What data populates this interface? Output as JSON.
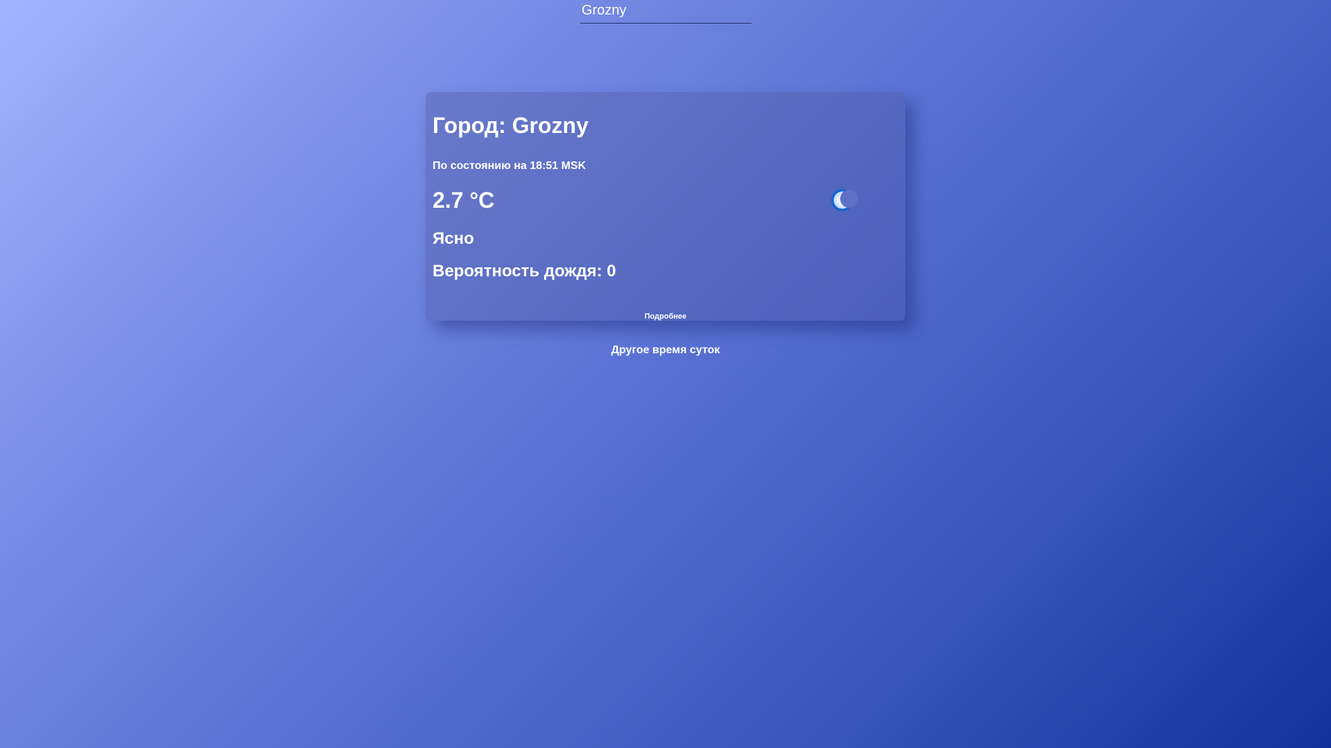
{
  "search": {
    "value": "Grozny"
  },
  "card": {
    "title": "Город: Grozny",
    "updated": "По состоянию на 18:51 MSK",
    "temperature": "2.7 °C",
    "condition": "Ясно",
    "rain_probability": "Вероятность дождя: 0",
    "icon": "moon-icon",
    "details_label": "Подробнее"
  },
  "other_time_label": "Другое время суток",
  "colors": {
    "background_start": "#a3b4ff",
    "background_end": "#12329a",
    "text": "#ffffff",
    "icon_ring": "#1565d8"
  }
}
